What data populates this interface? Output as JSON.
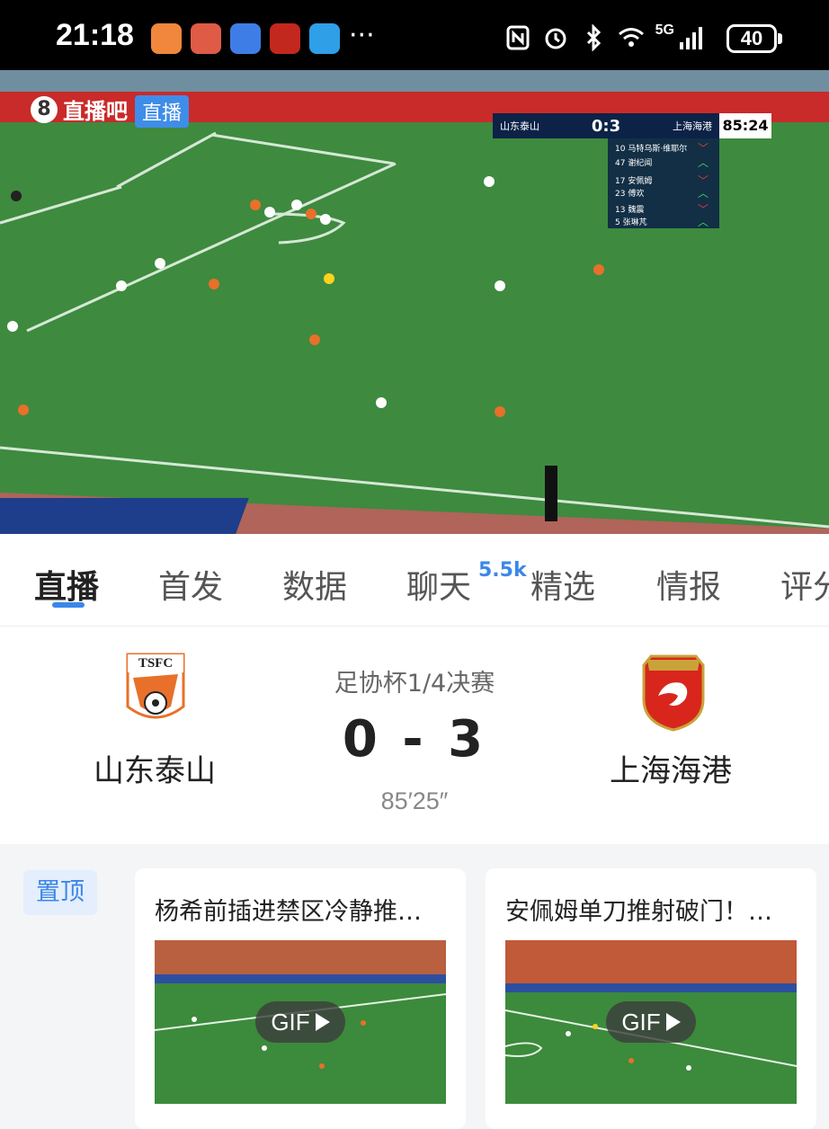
{
  "status_bar": {
    "time": "21:18",
    "network": "5G",
    "battery": "40",
    "more": "···"
  },
  "video": {
    "brand": "直播吧",
    "live_tag": "直播",
    "overlay": {
      "home": "山东泰山",
      "away": "上海海港",
      "score": "0:3",
      "time": "85:24"
    },
    "substitutions": [
      {
        "text": "10 马特乌斯·维耶尔",
        "dir": "down"
      },
      {
        "text": "47 谢纪闻",
        "dir": "up"
      },
      {
        "text": "17 安佩姆",
        "dir": "down"
      },
      {
        "text": "23 傅欢",
        "dir": "up"
      },
      {
        "text": "13 魏震",
        "dir": "down"
      },
      {
        "text": "5 张琳芃",
        "dir": "up"
      }
    ]
  },
  "tabs": [
    {
      "label": "直播",
      "active": true
    },
    {
      "label": "首发"
    },
    {
      "label": "数据"
    },
    {
      "label": "聊天",
      "badge": "5.5k"
    },
    {
      "label": "精选"
    },
    {
      "label": "情报"
    },
    {
      "label": "评分"
    }
  ],
  "match": {
    "competition": "足协杯1/4决赛",
    "home_team": "山东泰山",
    "away_team": "上海海港",
    "home_logo_text": "TSFC",
    "score": "0 - 3",
    "time": "85′25″"
  },
  "feed": {
    "pinned_label": "置顶",
    "cards": [
      {
        "title": "杨希前插进禁区冷静推…",
        "gif_label": "GIF"
      },
      {
        "title": "安佩姆单刀推射破门！…",
        "gif_label": "GIF"
      }
    ]
  },
  "colors": {
    "accent": "#3b87e8",
    "home_orange": "#e8702a",
    "away_red": "#d8261d"
  }
}
